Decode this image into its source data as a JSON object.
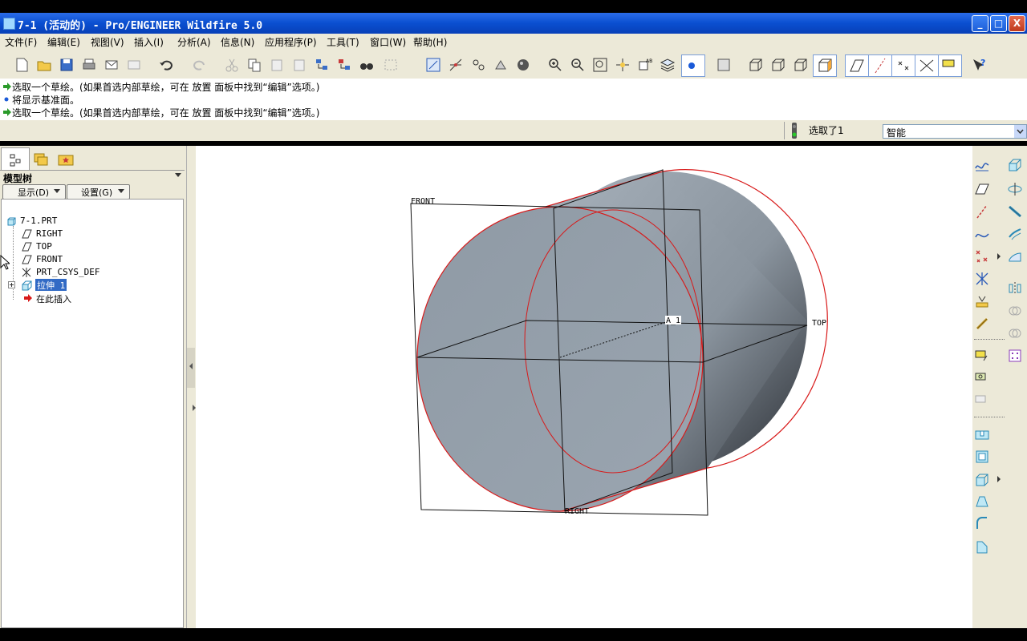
{
  "window": {
    "title": "7-1 (活动的) - Pro/ENGINEER Wildfire 5.0",
    "minimize": "_",
    "maximize": "□",
    "close": "X"
  },
  "menu": [
    "文件(F)",
    "编辑(E)",
    "视图(V)",
    "插入(I)",
    "分析(A)",
    "信息(N)",
    "应用程序(P)",
    "工具(T)",
    "窗口(W)",
    "帮助(H)"
  ],
  "messages": [
    {
      "text": "选取一个草绘。(如果首选内部草绘，可在 放置 面板中找到“编辑”选项。)",
      "icon": "arrow-right-icon"
    },
    {
      "text": "将显示基准面。",
      "icon": "bullet-icon"
    },
    {
      "text": "选取一个草绘。(如果首选内部草绘，可在 放置 面板中找到“编辑”选项。)",
      "icon": "arrow-right-icon"
    }
  ],
  "status": {
    "selected": "选取了1",
    "filter": "智能"
  },
  "modeltree": {
    "title": "模型树",
    "show_button": "显示(D)",
    "settings_button": "设置(G)",
    "items": [
      {
        "label": "7-1.PRT",
        "icon": "part-icon"
      },
      {
        "label": "RIGHT",
        "icon": "datum-plane-icon"
      },
      {
        "label": "TOP",
        "icon": "datum-plane-icon"
      },
      {
        "label": "FRONT",
        "icon": "datum-plane-icon"
      },
      {
        "label": "PRT_CSYS_DEF",
        "icon": "csys-icon"
      },
      {
        "label": "拉伸 1",
        "icon": "extrude-icon"
      },
      {
        "label": "在此插入",
        "icon": "insert-arrow-icon"
      }
    ]
  },
  "viewport": {
    "labels": {
      "front": "FRONT",
      "top": "TOP",
      "right": "RIGHT",
      "axis": "A_1"
    }
  },
  "colors": {
    "title": "#0a4fd0",
    "chrome": "#ece9d8",
    "edge": "#d81a1a",
    "body": "#9aa5b0"
  }
}
